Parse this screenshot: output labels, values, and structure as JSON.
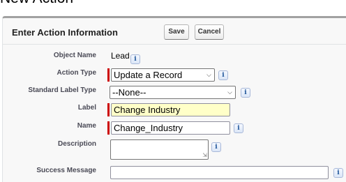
{
  "page": {
    "title": "New Action"
  },
  "panel": {
    "title": "Enter Action Information",
    "save_label": "Save",
    "cancel_label": "Cancel"
  },
  "form": {
    "object_name": {
      "label": "Object Name",
      "value": "Lead",
      "info_icon": "i"
    },
    "action_type": {
      "label": "Action Type",
      "value": "Update a Record",
      "info_icon": "i"
    },
    "standard_label_type": {
      "label": "Standard Label Type",
      "value": "--None--",
      "info_icon": "i"
    },
    "label": {
      "label": "Label",
      "value": "Change Industry"
    },
    "name": {
      "label": "Name",
      "value": "Change_Industry",
      "info_icon": "i"
    },
    "description": {
      "label": "Description",
      "value": "",
      "info_icon": "i"
    },
    "success_message": {
      "label": "Success Message",
      "value": "",
      "info_icon": "i"
    }
  },
  "colors": {
    "required_bar": "#cc0000",
    "label_highlight": "#ffffc8",
    "panel_border": "#a1a1a1",
    "info_icon": "#1b5297"
  }
}
